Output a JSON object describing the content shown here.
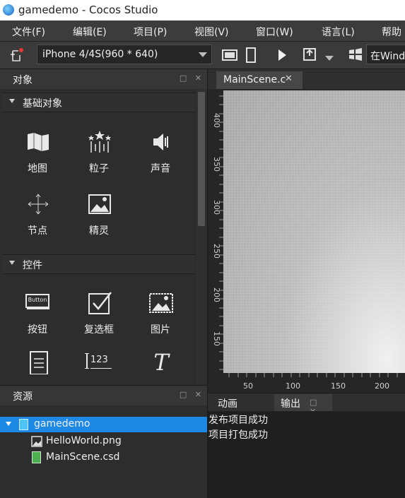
{
  "window": {
    "title": "gamedemo - Cocos Studio"
  },
  "menu": [
    "文件(F)",
    "编辑(E)",
    "项目(P)",
    "视图(V)",
    "窗口(W)",
    "语言(L)",
    "帮助"
  ],
  "toolbar": {
    "device": "iPhone 4/4S(960 * 640)",
    "run_target": "在Windo"
  },
  "objects_panel": {
    "title": "对象",
    "basic": {
      "header": "基础对象",
      "items": [
        {
          "label": "地图",
          "icon": "map-icon"
        },
        {
          "label": "粒子",
          "icon": "particle-icon"
        },
        {
          "label": "声音",
          "icon": "sound-icon"
        },
        {
          "label": "节点",
          "icon": "node-icon"
        },
        {
          "label": "精灵",
          "icon": "sprite-icon"
        }
      ]
    },
    "controls": {
      "header": "控件",
      "items": [
        {
          "label": "按钮",
          "icon": "button-icon",
          "icon_text": "Button"
        },
        {
          "label": "复选框",
          "icon": "checkbox-icon"
        },
        {
          "label": "图片",
          "icon": "image-icon"
        },
        {
          "label": "",
          "icon": "text-area-icon"
        },
        {
          "label": "",
          "icon": "number-label-icon",
          "icon_text": "123"
        },
        {
          "label": "",
          "icon": "text-icon",
          "icon_text": "T"
        }
      ]
    }
  },
  "resources_panel": {
    "title": "资源",
    "tree": [
      {
        "label": "gamedemo",
        "icon": "project-icon",
        "selected": true
      },
      {
        "label": "HelloWorld.png",
        "icon": "image-file-icon",
        "selected": false
      },
      {
        "label": "MainScene.csd",
        "icon": "csd-file-icon",
        "selected": false
      }
    ]
  },
  "editor": {
    "tab": "MainScene.c",
    "ruler_y": [
      "400",
      "350",
      "300",
      "250",
      "200",
      "150"
    ],
    "ruler_x": [
      "50",
      "100",
      "150",
      "200"
    ]
  },
  "bottom_panel": {
    "tabs": [
      "动画",
      "输出"
    ],
    "output_lines": [
      "发布项目成功",
      "项目打包成功"
    ]
  },
  "colors": {
    "selection": "#1e88e5",
    "accent": "#3d8fe0"
  }
}
